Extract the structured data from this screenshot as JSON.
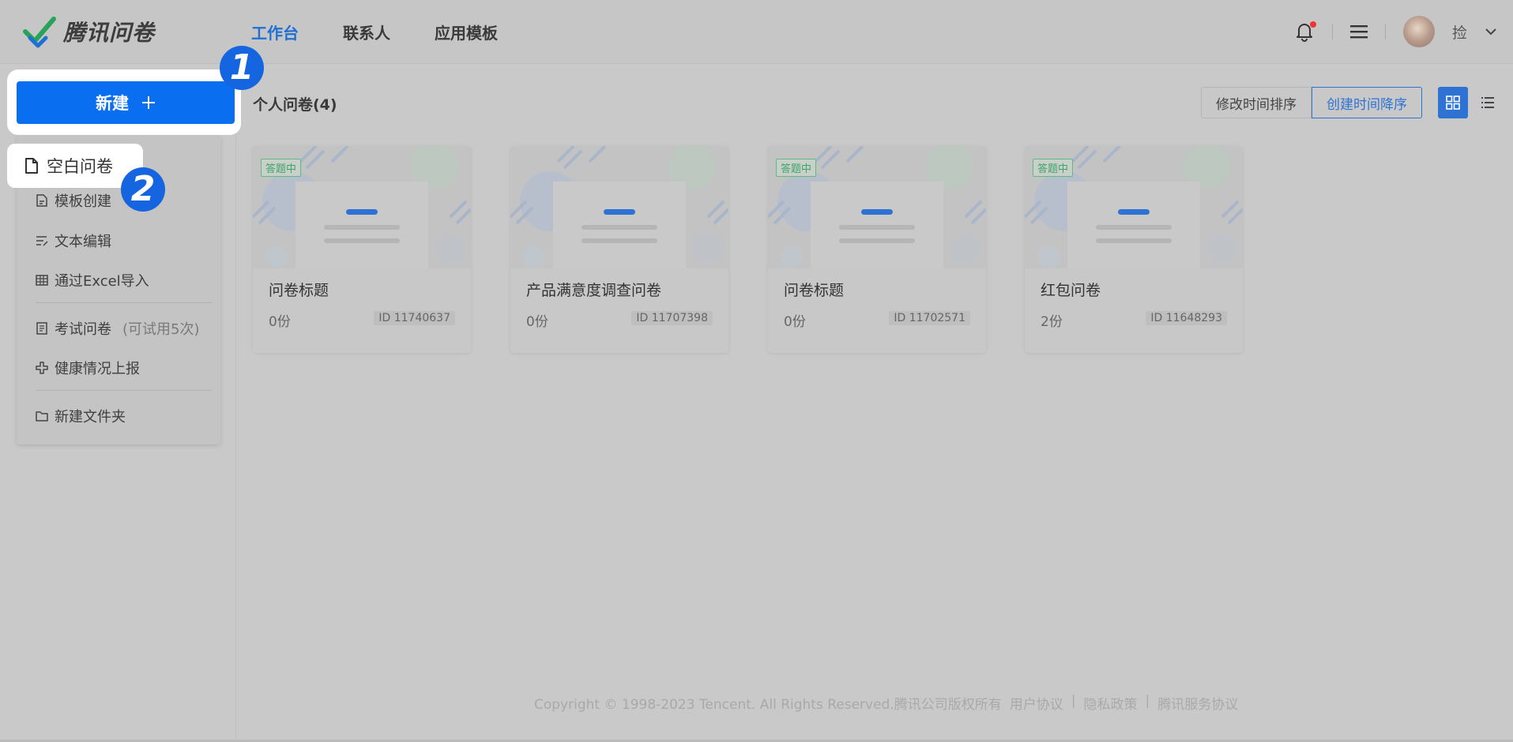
{
  "header": {
    "logo_text": "腾讯问卷",
    "nav": [
      {
        "label": "工作台",
        "active": true
      },
      {
        "label": "联系人",
        "active": false
      },
      {
        "label": "应用模板",
        "active": false
      }
    ],
    "user_name": "捡",
    "notification_dot_color": "#e33333"
  },
  "sidebar": {
    "new_button_label": "新建",
    "step_badges": [
      "1",
      "2"
    ],
    "menu": {
      "blank": "空白问卷",
      "template": "模板创建",
      "text_edit": "文本编辑",
      "excel_import": "通过Excel导入",
      "exam": "考试问卷",
      "exam_hint": "(可试用5次)",
      "health": "健康情况上报",
      "new_folder": "新建文件夹"
    }
  },
  "main": {
    "section_title": "个人问卷(4)",
    "sort_options": [
      "修改时间排序",
      "创建时间降序"
    ],
    "active_sort": "创建时间降序",
    "view_modes": [
      "grid-icon",
      "list-icon"
    ],
    "cards": [
      {
        "status": "答题中",
        "title": "问卷标题",
        "count": "0份",
        "id": "ID  11740637"
      },
      {
        "status": "",
        "title": "产品满意度调查问卷",
        "count": "0份",
        "id": "ID  11707398"
      },
      {
        "status": "答题中",
        "title": "问卷标题",
        "count": "0份",
        "id": "ID  11702571"
      },
      {
        "status": "答题中",
        "title": "红包问卷",
        "count": "2份",
        "id": "ID  11648293"
      }
    ]
  },
  "footer": {
    "copyright": "Copyright © 1998-2023 Tencent. All Rights Reserved.腾讯公司版权所有",
    "links": [
      "用户协议",
      "隐私政策",
      "腾讯服务协议"
    ],
    "sep": "|"
  },
  "colors": {
    "primary": "#0a6ef0",
    "accent": "#2e73d4",
    "status_green": "#3fa36a"
  }
}
